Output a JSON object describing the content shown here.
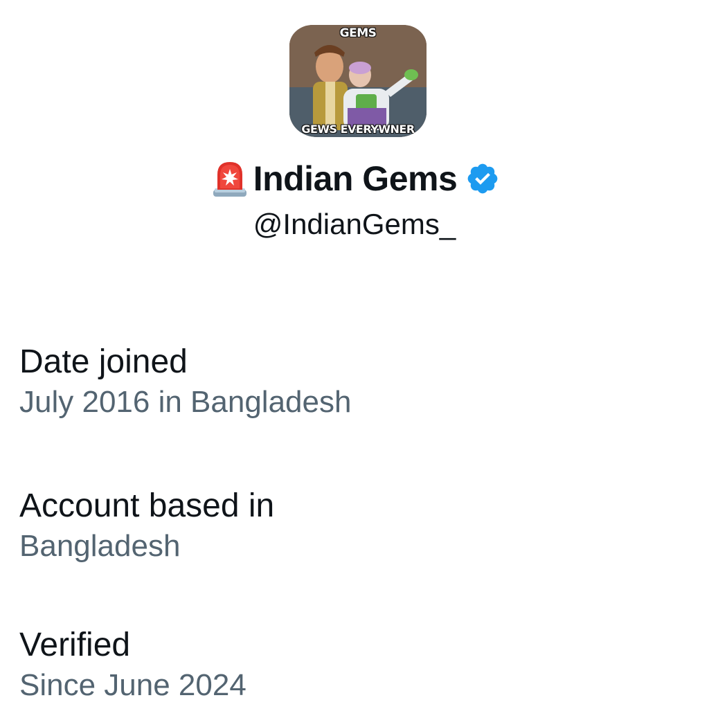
{
  "profile": {
    "avatar_text_top": "GEMS",
    "avatar_text_bottom": "GEWS EVERYWNER",
    "display_name": "Indian Gems",
    "handle": "@IndianGems_",
    "siren_icon": "rotating-light-icon",
    "verified_icon": "verified-badge-icon",
    "verified_color": "#1d9bf0"
  },
  "about": [
    {
      "label": "Date joined",
      "value": "July 2016 in Bangladesh"
    },
    {
      "label": "Account based in",
      "value": "Bangladesh"
    },
    {
      "label": "Verified",
      "value": "Since June 2024"
    }
  ],
  "colors": {
    "primary_text": "#0f1419",
    "secondary_text": "#536471"
  }
}
